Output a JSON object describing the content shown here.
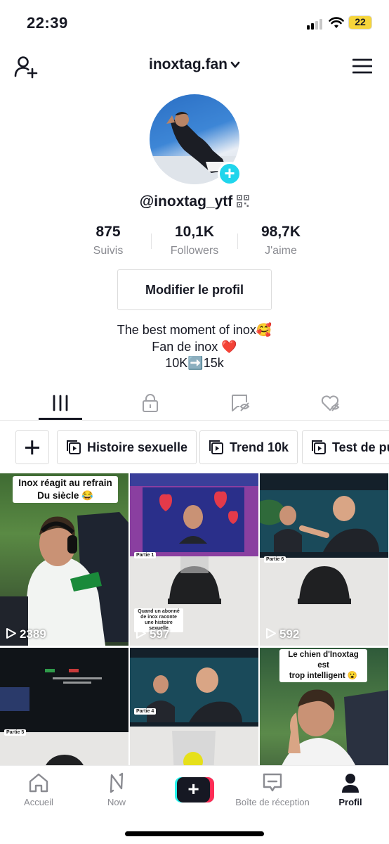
{
  "status_bar": {
    "time": "22:39",
    "battery": "22"
  },
  "header": {
    "account_name": "inoxtag.fan"
  },
  "profile": {
    "handle": "@inoxtag_ytf",
    "stats": [
      {
        "value": "875",
        "label": "Suivis"
      },
      {
        "value": "10,1K",
        "label": "Followers"
      },
      {
        "value": "98,7K",
        "label": "J'aime"
      }
    ],
    "edit_button": "Modifier le profil",
    "bio": [
      "The best moment of inox🥰",
      "Fan de inox ❤️",
      "10K➡️15k"
    ]
  },
  "tabs": [
    "videos-grid-icon",
    "lock-icon",
    "tagged-icon",
    "liked-heart-icon"
  ],
  "playlists": [
    "Histoire sexuelle",
    "Trend 10k",
    "Test de pu"
  ],
  "videos": [
    {
      "views": "2389",
      "caption": "Inox réagit au refrain\nDu siècle 😂"
    },
    {
      "views": "597",
      "tag": "Partie 1",
      "overlay": "Quand un abonné de inox raconte une histoire sexuelle"
    },
    {
      "views": "592",
      "tag": "Partie 6"
    },
    {
      "views": "",
      "tag": "Partie 5"
    },
    {
      "views": "",
      "tag": "Partie 4"
    },
    {
      "views": "",
      "caption": "Le chien d'Inoxtag est\ntrop intelligent 😮"
    }
  ],
  "bottom_nav": {
    "home": "Accueil",
    "now": "Now",
    "inbox": "Boîte de réception",
    "profile": "Profil"
  },
  "colors": {
    "accent_cyan": "#20d5ec",
    "create_red": "#fe2c55",
    "create_cyan": "#25f4ee",
    "text": "#161823",
    "muted": "#8a8b91"
  }
}
